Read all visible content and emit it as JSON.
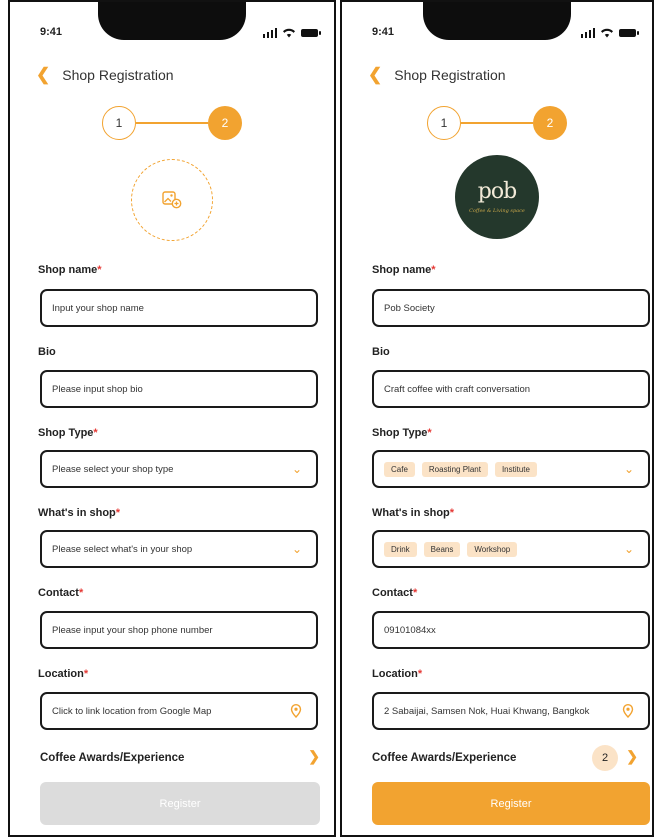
{
  "screens": [
    {
      "time": "9:41",
      "header": {
        "title": "Shop Registration"
      },
      "steps": [
        "1",
        "2"
      ],
      "fields": {
        "shop_name": {
          "label": "Shop name",
          "placeholder": "Input your shop name"
        },
        "bio": {
          "label": "Bio",
          "placeholder": "Please input shop bio"
        },
        "shop_type": {
          "label": "Shop Type",
          "placeholder": "Please select your shop type"
        },
        "whats_in_shop": {
          "label": "What's in shop",
          "placeholder": "Please select what's in your shop"
        },
        "contact": {
          "label": "Contact",
          "placeholder": "Please input your shop phone number"
        },
        "location": {
          "label": "Location",
          "placeholder": "Click to link location from Google Map"
        }
      },
      "awards_label": "Coffee Awards/Experience",
      "register_label": "Register"
    },
    {
      "time": "9:41",
      "header": {
        "title": "Shop Registration"
      },
      "steps": [
        "1",
        "2"
      ],
      "logo": {
        "mark": "pob",
        "tagline": "Coffee & Living space"
      },
      "fields": {
        "shop_name": {
          "label": "Shop name",
          "value": "Pob Society"
        },
        "bio": {
          "label": "Bio",
          "value": "Craft coffee with craft conversation"
        },
        "shop_type": {
          "label": "Shop Type",
          "chips": [
            "Cafe",
            "Roasting Plant",
            "Institute"
          ]
        },
        "whats_in_shop": {
          "label": "What's in shop",
          "chips": [
            "Drink",
            "Beans",
            "Workshop"
          ]
        },
        "contact": {
          "label": "Contact",
          "value": "09101084xx"
        },
        "location": {
          "label": "Location",
          "value": "2 Sabaijai, Samsen Nok, Huai Khwang, Bangkok"
        }
      },
      "awards_label": "Coffee Awards/Experience",
      "awards_count": "2",
      "register_label": "Register"
    }
  ],
  "colors": {
    "accent": "#F2A330",
    "chip_bg": "#fbe3c7",
    "required": "#e53935",
    "disabled": "#dcdcdc"
  }
}
